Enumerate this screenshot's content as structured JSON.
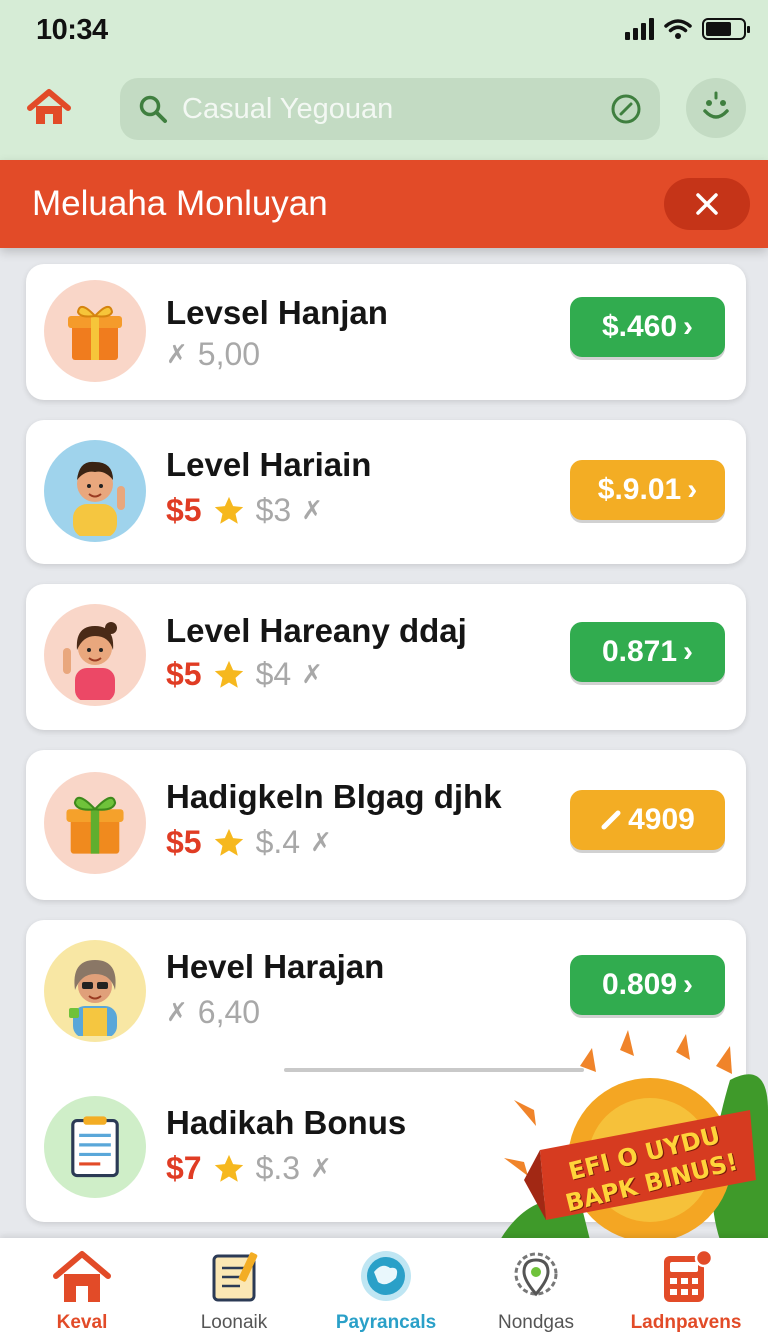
{
  "status_bar": {
    "time": "10:34"
  },
  "search": {
    "placeholder": "Casual Yegouan"
  },
  "banner": {
    "title": "Meluaha Monluyan",
    "close_symbol": "✕"
  },
  "items": [
    {
      "title": "Levsel Hanjan",
      "gray_price": "5,00",
      "amount": "$.460",
      "chevron": "›",
      "button_color": "green",
      "icon": "gift-box-icon"
    },
    {
      "title": "Level Hariain",
      "red_price": "$5",
      "gray_price": "$3",
      "amount": "$.9.01",
      "chevron": "›",
      "button_color": "orange",
      "icon": "boy-avatar-icon"
    },
    {
      "title": "Level Hareany ddaj",
      "red_price": "$5",
      "gray_price": "$4",
      "amount": "0.871",
      "chevron": "›",
      "button_color": "green",
      "icon": "girl-avatar-icon"
    },
    {
      "title": "Hadigkeln Blgag djhk",
      "red_price": "$5",
      "gray_price": "$.4",
      "amount": "4909",
      "button_color": "orange",
      "icon": "green-gift-icon"
    },
    {
      "title": "Hevel Harajan",
      "gray_price": "6,40",
      "amount": "0.809",
      "chevron": "›",
      "button_color": "green",
      "icon": "woman-avatar-icon"
    },
    {
      "title": "Hadikah Bonus",
      "red_price": "$7",
      "gray_price": "$.3",
      "icon": "notepad-icon"
    }
  ],
  "promo": {
    "line1": "EFI O UYDU",
    "line2": "BAPK BINUS!"
  },
  "nav": [
    {
      "label": "Keval",
      "icon": "home-icon",
      "color": "#e24b28"
    },
    {
      "label": "Loonaik",
      "icon": "notebook-icon",
      "color": "#555555"
    },
    {
      "label": "Payrancals",
      "icon": "globe-icon",
      "color": "#2aa0c8"
    },
    {
      "label": "Nondgas",
      "icon": "map-pin-icon",
      "color": "#555555"
    },
    {
      "label": "Ladnpavens",
      "icon": "calculator-icon",
      "color": "#e24b28"
    }
  ],
  "colors": {
    "accent": "#e24b28",
    "green": "#31ac4f",
    "orange": "#f3ad24",
    "header_bg": "#d6ecd6"
  }
}
